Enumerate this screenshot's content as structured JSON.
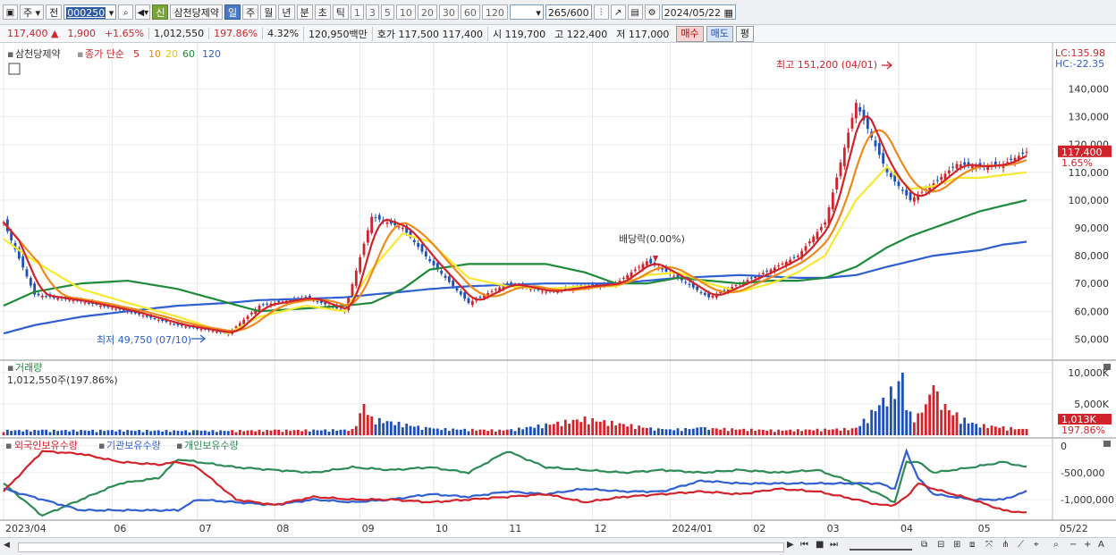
{
  "toolbar": {
    "period_unit": "주",
    "prev_label": "전",
    "stock_code": "000250",
    "new_badge": "신",
    "stock_name": "삼천당제약",
    "period_tabs": [
      "일",
      "주",
      "월",
      "년",
      "분",
      "초",
      "틱"
    ],
    "active_tab": "일",
    "minute_options": [
      "1",
      "3",
      "5",
      "10",
      "20",
      "30",
      "60",
      "120"
    ],
    "count_shown": "265",
    "count_total": "/600",
    "date": "2024/05/22"
  },
  "quote": {
    "price": "117,400",
    "direction": "▲",
    "change": "1,900",
    "change_pct": "+1.65%",
    "volume": "1,012,550",
    "volume_ratio": "197.86%",
    "turnover": "4.32%",
    "amount": "120,950백만",
    "bid_ask_label": "호가",
    "ask": "117,500",
    "bid": "117,400",
    "open_label": "시",
    "open": "119,700",
    "high_label": "고",
    "high": "122,400",
    "low_label": "저",
    "low": "117,000",
    "buy_label": "매수",
    "sell_label": "매도",
    "avg_label": "평"
  },
  "chart_data": {
    "type": "line",
    "colors": {
      "price": "#d2232a",
      "ma5": "#d2232a",
      "ma10": "#ee8a1c",
      "ma20": "#f7ea2e",
      "ma60": "#1f8b3a",
      "ma120": "#2f5fd0",
      "up": "#d2232a",
      "down": "#1c4fb8"
    },
    "price_panel": {
      "legend_name": "삼천당제약",
      "legend_items": [
        "종가 단순",
        "5",
        "10",
        "20",
        "60",
        "120"
      ],
      "ylim": [
        44000,
        154000
      ],
      "y_ticks": [
        "140,000",
        "130,000",
        "120,000",
        "110,000",
        "100,000",
        "90,000",
        "80,000",
        "70,000",
        "60,000",
        "50,000"
      ],
      "lc_label": "LC:135.98",
      "hc_label": "HC:-22.35",
      "current_price_tag": "117,400",
      "current_change_tag": "1.65%",
      "annotations": {
        "high": "최고 151,200 (04/01)",
        "low": "최저 49,750 (07/10)",
        "dividend": "배당락(0.00%)"
      },
      "x_index": [
        0,
        8,
        20,
        32,
        45,
        58,
        66,
        78,
        88,
        95,
        103,
        110,
        120,
        130,
        140,
        150,
        158,
        166,
        174,
        182,
        190,
        198,
        205,
        212,
        220,
        228,
        234,
        240,
        246,
        252,
        258,
        264
      ],
      "close": [
        92000,
        66000,
        63500,
        60000,
        55000,
        52000,
        62000,
        65000,
        60000,
        94000,
        90000,
        78000,
        63000,
        70000,
        67000,
        69000,
        70000,
        78000,
        72000,
        65000,
        70000,
        75000,
        80000,
        92000,
        135000,
        110000,
        100000,
        106000,
        113000,
        112000,
        113000,
        117400
      ],
      "ma20": [
        86000,
        78000,
        68000,
        63000,
        58000,
        52000,
        58000,
        62000,
        60000,
        75000,
        88000,
        85000,
        72000,
        69000,
        68000,
        69000,
        69000,
        73000,
        74000,
        70000,
        67000,
        70000,
        74000,
        80000,
        100000,
        112000,
        104000,
        105000,
        108000,
        108000,
        109000,
        110000
      ],
      "ma60": [
        62000,
        67000,
        70000,
        71000,
        68000,
        63000,
        60000,
        61000,
        62000,
        63000,
        68000,
        75000,
        77000,
        77000,
        77000,
        74000,
        70000,
        70000,
        72000,
        71000,
        70000,
        71000,
        71000,
        72000,
        76000,
        83000,
        87000,
        90000,
        93000,
        96000,
        98000,
        100000
      ],
      "ma120": [
        52000,
        55000,
        58000,
        60000,
        62000,
        63000,
        64000,
        64500,
        65000,
        66000,
        67000,
        68000,
        69000,
        69500,
        70000,
        70000,
        70000,
        71000,
        72000,
        72500,
        73000,
        72500,
        72000,
        72000,
        73000,
        76000,
        78000,
        80000,
        81000,
        82000,
        84000,
        85000
      ]
    },
    "volume_panel": {
      "label": "거래량",
      "current_text": "1,012,550주(197.86%)",
      "ylim": [
        0,
        11000
      ],
      "unit": "K",
      "y_ticks": [
        "10,000K",
        "5,000K"
      ],
      "current_tag": "1,013K",
      "current_pct_tag": "197.86%",
      "x_index": [
        10,
        30,
        50,
        70,
        90,
        93,
        95,
        110,
        130,
        150,
        170,
        180,
        200,
        220,
        232,
        233,
        236,
        240,
        243,
        250,
        260,
        264
      ],
      "values": [
        900,
        900,
        800,
        900,
        1000,
        5000,
        3000,
        1200,
        900,
        3000,
        1000,
        1300,
        900,
        1200,
        10000,
        4000,
        3500,
        8000,
        5000,
        2000,
        1300,
        1013
      ]
    },
    "ownership_panel": {
      "legend": [
        "외국인보유수량",
        "기관보유수량",
        "개인보유수량"
      ],
      "series_colors": [
        "#d2232a",
        "#2f5fd0",
        "#2e8b57"
      ],
      "ylim": [
        -1350000,
        80000
      ],
      "y_ticks": [
        "0",
        "-500,000",
        "-1,000,000"
      ],
      "x_index": [
        0,
        10,
        20,
        30,
        40,
        45,
        50,
        60,
        70,
        80,
        90,
        100,
        110,
        120,
        130,
        140,
        150,
        160,
        170,
        180,
        190,
        200,
        210,
        220,
        226,
        230,
        233,
        236,
        240,
        250,
        258,
        264
      ],
      "foreign": [
        -850000,
        -100000,
        -150000,
        -300000,
        -350000,
        -300000,
        -400000,
        -1000000,
        -1100000,
        -950000,
        -1000000,
        -1000000,
        -1050000,
        -1000000,
        -950000,
        -900000,
        -1050000,
        -950000,
        -900000,
        -850000,
        -900000,
        -800000,
        -850000,
        -1000000,
        -1100000,
        -1100000,
        -950000,
        -700000,
        -800000,
        -1000000,
        -1200000,
        -1250000
      ],
      "institution": [
        -800000,
        -1000000,
        -1200000,
        -1200000,
        -1200000,
        -1200000,
        -1000000,
        -1050000,
        -1100000,
        -1000000,
        -1050000,
        -1000000,
        -900000,
        -950000,
        -850000,
        -900000,
        -800000,
        -850000,
        -850000,
        -650000,
        -700000,
        -700000,
        -700000,
        -700000,
        -700000,
        -800000,
        -100000,
        -600000,
        -900000,
        -1000000,
        -1000000,
        -850000
      ],
      "individual": [
        -700000,
        -1300000,
        -1000000,
        -700000,
        -600000,
        -250000,
        -300000,
        -400000,
        -450000,
        -500000,
        -400000,
        -450000,
        -400000,
        -500000,
        -100000,
        -400000,
        -450000,
        -500000,
        -450000,
        -500000,
        -450000,
        -500000,
        -450000,
        -700000,
        -900000,
        -1050000,
        -300000,
        -300000,
        -500000,
        -400000,
        -300000,
        -400000
      ]
    },
    "x_labels": [
      {
        "i": 0,
        "t": "2023/04"
      },
      {
        "i": 28,
        "t": "06"
      },
      {
        "i": 50,
        "t": "07"
      },
      {
        "i": 70,
        "t": "08"
      },
      {
        "i": 92,
        "t": "09"
      },
      {
        "i": 111,
        "t": "10"
      },
      {
        "i": 130,
        "t": "11"
      },
      {
        "i": 152,
        "t": "12"
      },
      {
        "i": 172,
        "t": "2024/01"
      },
      {
        "i": 193,
        "t": "02"
      },
      {
        "i": 212,
        "t": "03"
      },
      {
        "i": 231,
        "t": "04"
      },
      {
        "i": 251,
        "t": "05"
      }
    ],
    "x_end_label": "05/22",
    "total_bars": 265
  }
}
